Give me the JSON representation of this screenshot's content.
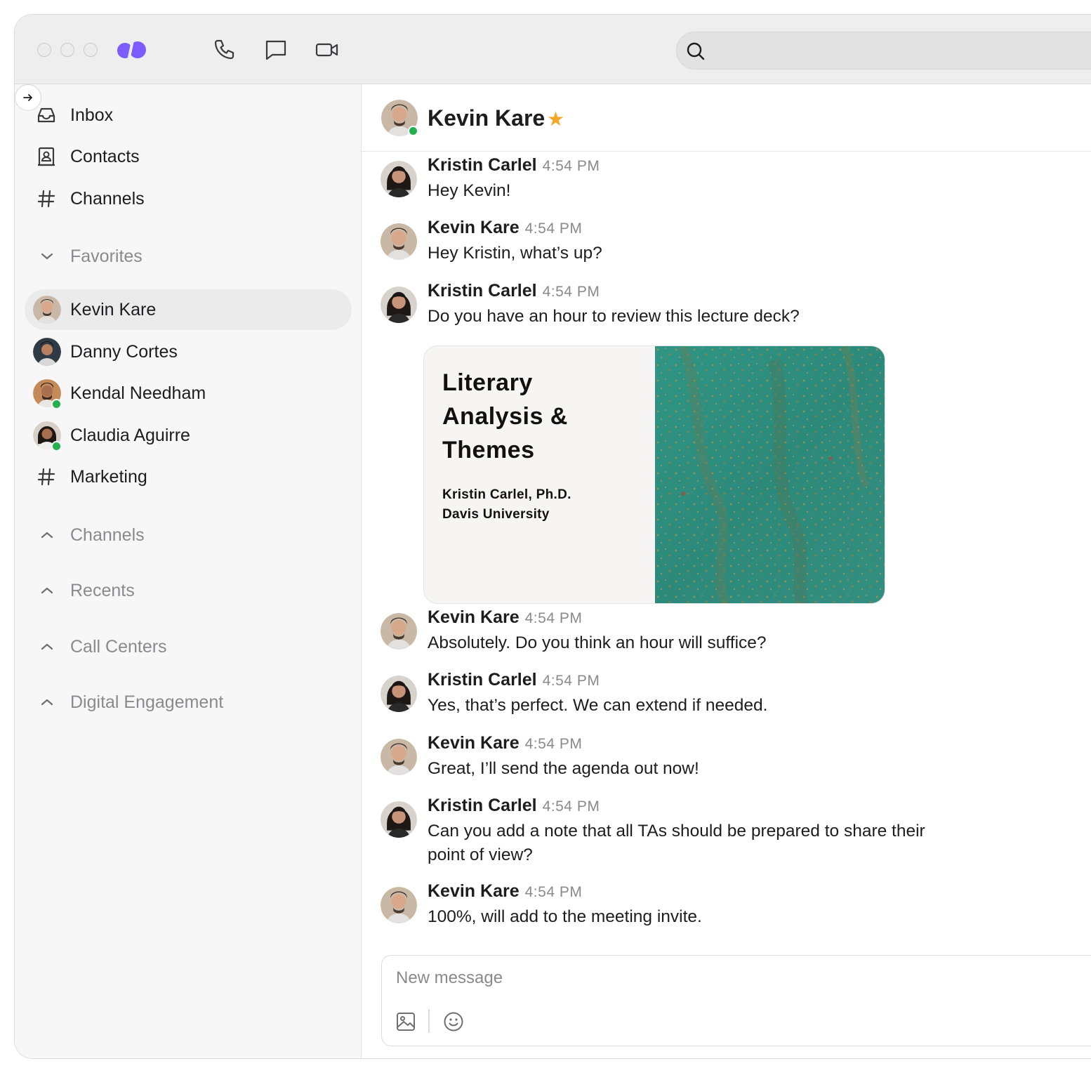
{
  "titlebar": {
    "search_placeholder": ""
  },
  "sidebar": {
    "nav": [
      {
        "label": "Inbox",
        "icon": "inbox-icon"
      },
      {
        "label": "Contacts",
        "icon": "contacts-icon"
      },
      {
        "label": "Channels",
        "icon": "hash-icon"
      }
    ],
    "favorites_label": "Favorites",
    "favorites": [
      {
        "label": "Kevin Kare",
        "online": false,
        "active": true
      },
      {
        "label": "Danny Cortes",
        "online": false
      },
      {
        "label": "Kendal Needham",
        "online": true
      },
      {
        "label": "Claudia Aguirre",
        "online": true
      },
      {
        "label": "Marketing",
        "icon": "hash-icon"
      }
    ],
    "sections": [
      {
        "label": "Channels"
      },
      {
        "label": "Recents"
      },
      {
        "label": "Call Centers"
      },
      {
        "label": "Digital Engagement"
      }
    ]
  },
  "chat": {
    "title": "Kevin Kare",
    "starred": true,
    "messages": [
      {
        "name": "Kristin Carlel",
        "time": "4:54 PM",
        "text": [
          "Hey Kevin!"
        ]
      },
      {
        "name": "Kevin Kare",
        "time": "4:54 PM",
        "text": [
          "Hey Kristin, what’s up?"
        ]
      },
      {
        "name": "Kristin Carlel",
        "time": "4:54 PM",
        "text": [
          "Do you have an hour to review this lecture deck?"
        ]
      },
      {
        "name": "Kevin Kare",
        "time": "4:54 PM",
        "text": [
          "Absolutely. Do you think an hour will suffice?"
        ]
      },
      {
        "name": "Kristin Carlel",
        "time": "4:54 PM",
        "text": [
          "Yes, that’s perfect. We can extend if needed."
        ]
      },
      {
        "name": "Kevin Kare",
        "time": "4:54 PM",
        "text": [
          "Great, I’ll send the agenda out now!"
        ]
      },
      {
        "name": "Kristin Carlel",
        "time": "4:54 PM",
        "text": [
          "Can you add a note that all TAs should be prepared to share their",
          "point of view?"
        ]
      },
      {
        "name": "Kevin Kare",
        "time": "4:54 PM",
        "text": [
          "100%, will add to the meeting invite."
        ]
      }
    ],
    "attachment": {
      "title_lines": [
        "Literary",
        "Analysis &",
        "Themes"
      ],
      "author_lines": [
        "Kristin Carlel, Ph.D.",
        "Davis University"
      ]
    },
    "composer": {
      "placeholder": "New message"
    }
  },
  "colors": {
    "brand": "#7c5cff",
    "online": "#22b14c",
    "star": "#f5a623",
    "deck_art": "#2f8e7f"
  }
}
